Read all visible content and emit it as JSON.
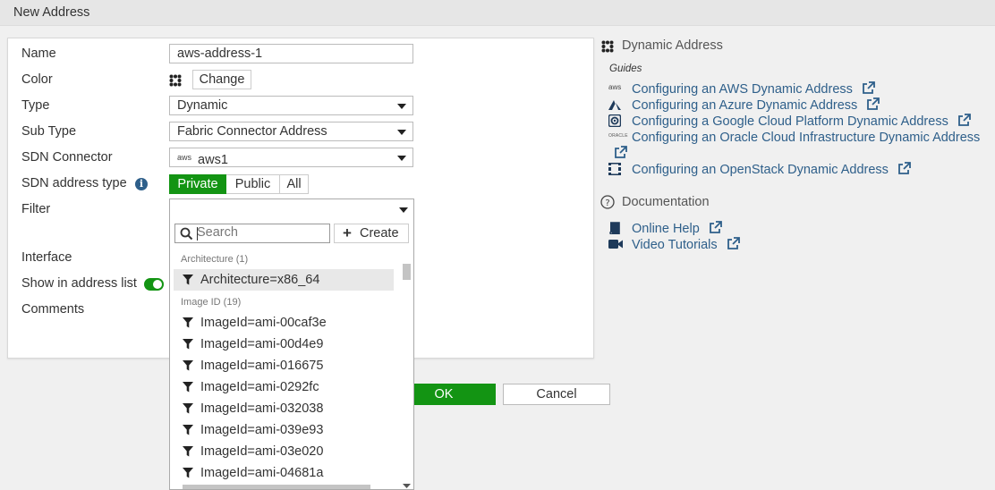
{
  "window": {
    "title": "New Address"
  },
  "form": {
    "name_label": "Name",
    "name_value": "aws-address-1",
    "color_label": "Color",
    "color_button": "Change",
    "type_label": "Type",
    "type_value": "Dynamic",
    "subtype_label": "Sub Type",
    "subtype_value": "Fabric Connector Address",
    "sdn_connector_label": "SDN Connector",
    "sdn_connector_icon_text": "aws",
    "sdn_connector_value": "aws1",
    "sdn_type_label": "SDN address type",
    "sdn_type_options": [
      "Private",
      "Public",
      "All"
    ],
    "sdn_type_selected": "Private",
    "filter_label": "Filter",
    "interface_label": "Interface",
    "show_label": "Show in address list",
    "show_enabled": true,
    "comments_label": "Comments"
  },
  "filter_dropdown": {
    "search_placeholder": "Search",
    "create_label": "Create",
    "groups": [
      {
        "header": "Architecture (1)",
        "items": [
          "Architecture=x86_64"
        ]
      },
      {
        "header": "Image ID (19)",
        "items": [
          "ImageId=ami-00caf3e",
          "ImageId=ami-00d4e9",
          "ImageId=ami-016675",
          "ImageId=ami-0292fc",
          "ImageId=ami-032038",
          "ImageId=ami-039e93",
          "ImageId=ami-03e020",
          "ImageId=ami-04681a"
        ]
      }
    ],
    "selected_item": "Architecture=x86_64"
  },
  "buttons": {
    "ok": "OK",
    "cancel": "Cancel"
  },
  "sidebar": {
    "dynamic_address_title": "Dynamic Address",
    "guides_label": "Guides",
    "guides": [
      {
        "icon": "aws-icon",
        "icon_text": "aws",
        "label": "Configuring an AWS Dynamic Address"
      },
      {
        "icon": "azure-icon",
        "label": "Configuring an Azure Dynamic Address"
      },
      {
        "icon": "gcp-icon",
        "label": "Configuring a Google Cloud Platform Dynamic Address"
      },
      {
        "icon": "oracle-icon",
        "icon_text": "ORACLE",
        "label": "Configuring an Oracle Cloud Infrastructure Dynamic Address"
      },
      {
        "icon": "openstack-icon",
        "label": "Configuring an OpenStack Dynamic Address"
      }
    ],
    "documentation_title": "Documentation",
    "docs": [
      {
        "icon": "book-icon",
        "label": "Online Help"
      },
      {
        "icon": "video-icon",
        "label": "Video Tutorials"
      }
    ]
  },
  "colors": {
    "accent_green": "#139413",
    "link_blue": "#2e5f8a"
  }
}
